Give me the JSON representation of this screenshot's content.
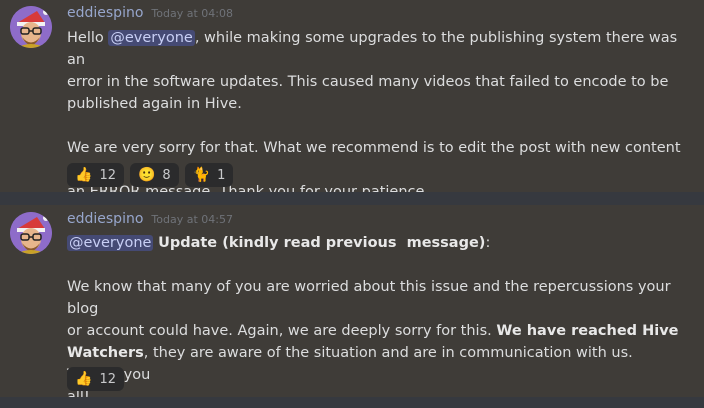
{
  "messages": [
    {
      "username": "eddiespino",
      "timestamp": "Today at 04:08",
      "lines": [
        "Hello ",
        "@everyone",
        ", while making some upgrades to the publishing system there was an",
        "error in the software updates. This caused many videos that failed to encode to be",
        "published again in Hive.",
        "",
        "We are very sorry for that. What we recommend is to edit the post with new content or",
        "an ERROR message. Thank you for your patience."
      ],
      "reactions": [
        {
          "emoji": "👍",
          "count": "12"
        },
        {
          "emoji": "🙂",
          "count": "8"
        },
        {
          "emoji": "🐈",
          "count": "1"
        }
      ]
    },
    {
      "username": "eddiespino",
      "timestamp": "Today at 04:57",
      "heading_mention": "@everyone",
      "heading_text": "Update (kindly read previous  message)",
      "heading_suffix": ":",
      "body_line1": "We know that many of you are worried about this issue and the repercussions your blog",
      "body_line2_start": "or account could have. Again, we are deeply sorry for this. ",
      "body_line2_bold": "We have reached Hive",
      "body_line3_bold": "Watchers",
      "body_line3_rest": ", they are aware of the situation and are in communication with us. Thanks you",
      "body_line4": "all!",
      "reactions": [
        {
          "emoji": "👍",
          "count": "12"
        }
      ]
    }
  ]
}
